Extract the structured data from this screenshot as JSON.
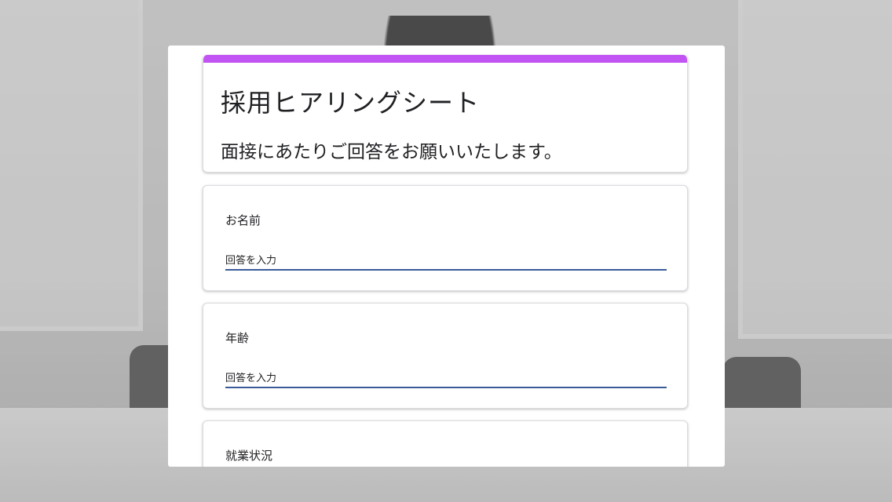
{
  "form": {
    "title": "採用ヒアリングシート",
    "description": "面接にあたりご回答をお願いいたします。",
    "accent_color": "#c154f2",
    "questions": [
      {
        "label": "お名前",
        "placeholder": "回答を入力"
      },
      {
        "label": "年齢",
        "placeholder": "回答を入力"
      },
      {
        "label": "就業状況"
      }
    ]
  }
}
